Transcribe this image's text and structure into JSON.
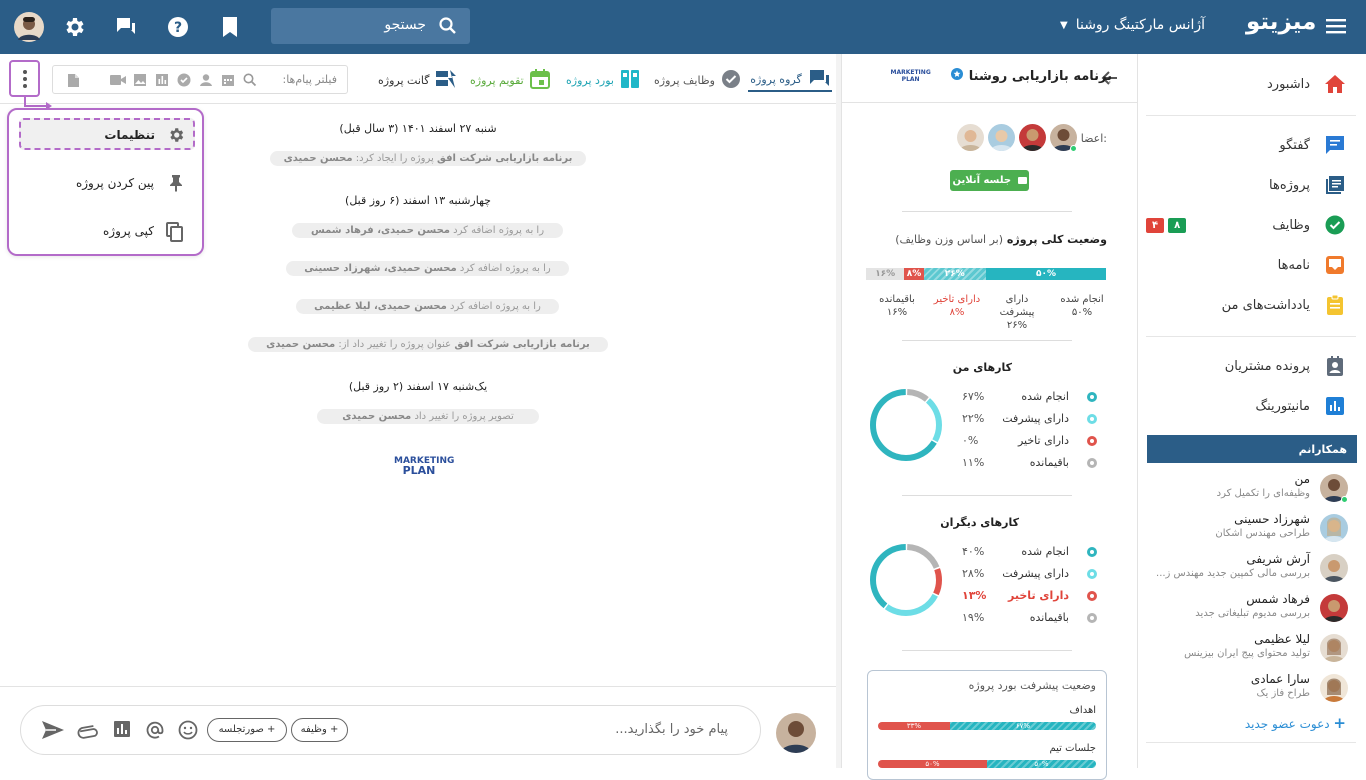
{
  "header": {
    "brand": "میزیتو",
    "workspace": "آژانس مارکتینگ روشنا",
    "search_placeholder": "جستجو"
  },
  "sidebar": {
    "items": [
      {
        "label": "داشبورد",
        "icon": "home-icon"
      },
      {
        "label": "گفتگو",
        "icon": "chat-icon"
      },
      {
        "label": "پروژه‌ها",
        "icon": "projects-icon"
      },
      {
        "label": "وظایف",
        "icon": "tasks-icon",
        "badges": [
          "۸",
          "۴"
        ]
      },
      {
        "label": "نامه‌ها",
        "icon": "mail-icon"
      },
      {
        "label": "یادداشت‌های من",
        "icon": "notes-icon"
      },
      {
        "label": "پرونده مشتریان",
        "icon": "contacts-icon"
      },
      {
        "label": "مانیتورینگ",
        "icon": "monitoring-icon"
      }
    ],
    "colleagues_title": "همکارانم",
    "colleagues": [
      {
        "name": "من",
        "desc": "وظیفه‌ای را تکمیل کرد"
      },
      {
        "name": "شهرزاد حسینی",
        "desc": "طراحی مهندس اشکان"
      },
      {
        "name": "آرش شریفی",
        "desc": "بررسی مالی کمپین جدید مهندس ز..."
      },
      {
        "name": "فرهاد شمس",
        "desc": "بررسی مدیوم تبلیغاتی جدید"
      },
      {
        "name": "لیلا عظیمی",
        "desc": "تولید محتوای پیج ایران بیزینس"
      },
      {
        "name": "سارا عمادی",
        "desc": "طراح فاز یک"
      }
    ],
    "invite": "دعوت عضو جدید"
  },
  "project": {
    "title": "برنامه بازاریابی روشنا",
    "logo_text": [
      "MARKETING",
      "PLAN"
    ],
    "members_label": "اعضا:",
    "online_meeting": "جلسه آنلاین",
    "overall_title": "وضعیت کلی پروژه",
    "overall_sub": "(بر اساس وزن وظایف)",
    "overall": [
      {
        "label": "انجام شده",
        "value": "۵۰%",
        "pct": 50,
        "color": "#26b5c0"
      },
      {
        "label": "دارای پیشرفت",
        "value": "۲۶%",
        "pct": 26,
        "color": "#5cc8d0"
      },
      {
        "label": "دارای تاخیر",
        "value": "۸%",
        "pct": 8,
        "color": "#e0544c"
      },
      {
        "label": "باقیمانده",
        "value": "۱۶%",
        "pct": 16,
        "color": "#e4e4e4"
      }
    ],
    "my_tasks_title": "کارهای من",
    "my_tasks": [
      {
        "label": "انجام شده",
        "value": "۶۷%",
        "pct": 67,
        "color": "#2fb5bf"
      },
      {
        "label": "دارای پیشرفت",
        "value": "۲۲%",
        "pct": 22,
        "color": "#6ddde6"
      },
      {
        "label": "دارای تاخیر",
        "value": "۰%",
        "pct": 0,
        "color": "#e0544c"
      },
      {
        "label": "باقیمانده",
        "value": "۱۱%",
        "pct": 11,
        "color": "#b5b5b5"
      }
    ],
    "others_title": "کارهای دیگران",
    "others": [
      {
        "label": "انجام شده",
        "value": "۴۰%",
        "pct": 40,
        "color": "#2fb5bf"
      },
      {
        "label": "دارای پیشرفت",
        "value": "۲۸%",
        "pct": 28,
        "color": "#6ddde6"
      },
      {
        "label": "دارای تاخیر",
        "value": "۱۳%",
        "pct": 13,
        "color": "#e0544c"
      },
      {
        "label": "باقیمانده",
        "value": "۱۹%",
        "pct": 19,
        "color": "#b5b5b5"
      }
    ],
    "board_title": "وضعیت پیشرفت بورد پروژه",
    "board_rows": [
      {
        "label": "اهداف",
        "done": "۶۷%",
        "late": "۳۳%",
        "done_pct": 67,
        "late_pct": 33
      },
      {
        "label": "جلسات تیم",
        "done": "۵۰%",
        "late": "۵۰%",
        "done_pct": 50,
        "late_pct": 50
      }
    ]
  },
  "tabs": [
    {
      "label": "گروه پروژه",
      "active": true
    },
    {
      "label": "وظایف پروژه"
    },
    {
      "label": "بورد پروژه"
    },
    {
      "label": "تقویم پروژه"
    },
    {
      "label": "گانت پروژه"
    }
  ],
  "filter_label": "فیلتر پیام‌ها:",
  "menu": {
    "settings": "تنظیمات",
    "pin": "پین کردن پروژه",
    "copy": "کپی پروژه"
  },
  "feed": {
    "d1": "شنبه ۲۷ اسفند ۱۴۰۱ (۳ سال قبل)",
    "e1_actor": "محسن حمیدی",
    "e1_text": "پروژه را ایجاد کرد:",
    "e1_obj": "برنامه بازاریابی شرکت افق",
    "d2": "چهارشنبه ۱۳ اسفند (۶ روز قبل)",
    "e2_actor": "محسن حمیدی، فرهاد شمس",
    "e2_text": "را به پروژه اضافه کرد",
    "e3_actor": "محسن حمیدی، شهرزاد حسینی",
    "e3_text": "را به پروژه اضافه کرد",
    "e4_actor": "محسن حمیدی، لیلا عظیمی",
    "e4_text": "را به پروژه اضافه کرد",
    "e5_actor": "محسن حمیدی",
    "e5_text": "عنوان پروژه را تغییر داد از:",
    "e5_obj": "برنامه بازاریابی شرکت افق",
    "d3": "یک‌شنبه ۱۷ اسفند (۲ روز قبل)",
    "e6_actor": "محسن حمیدی",
    "e6_text": "تصویر پروژه را تغییر داد",
    "logo": [
      "MARKETING",
      "PLAN"
    ]
  },
  "composer": {
    "placeholder": "پیام خود را بگذارید...",
    "chip_task": "+ وظیفه",
    "chip_minutes": "+ صورتجلسه"
  }
}
